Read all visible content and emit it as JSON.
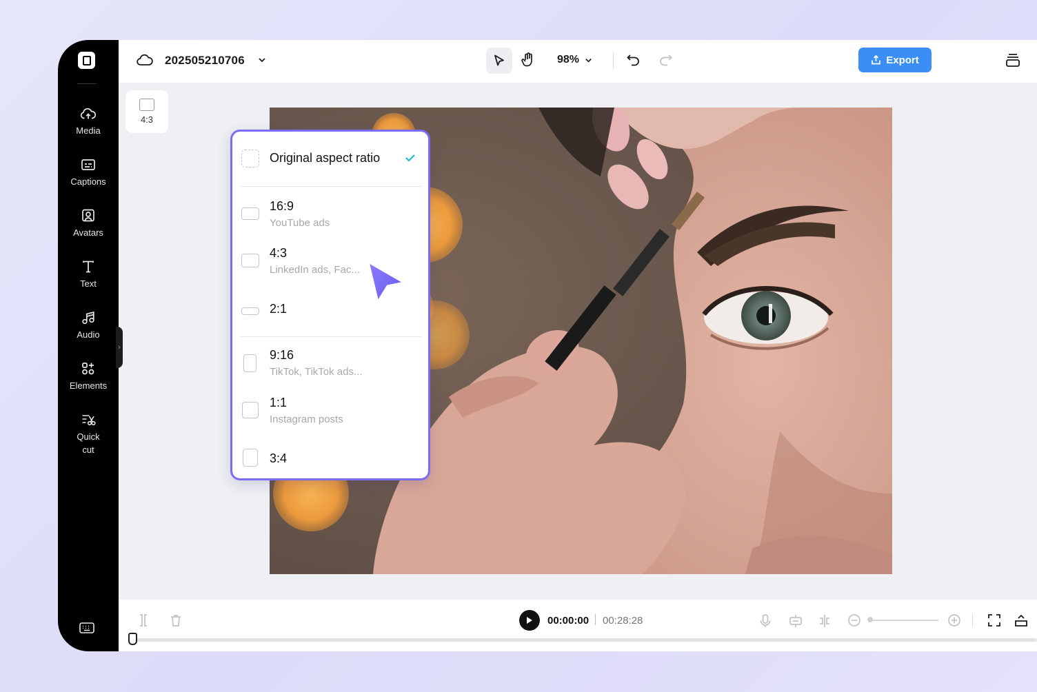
{
  "sidebar": {
    "items": [
      {
        "label": "Media",
        "icon": "cloud-upload-icon"
      },
      {
        "label": "Captions",
        "icon": "captions-icon"
      },
      {
        "label": "Avatars",
        "icon": "avatar-icon"
      },
      {
        "label": "Text",
        "icon": "text-icon"
      },
      {
        "label": "Audio",
        "icon": "music-note-icon"
      },
      {
        "label": "Elements",
        "icon": "elements-icon"
      },
      {
        "label": "Quick\ncut",
        "icon": "quick-cut-icon"
      }
    ],
    "bottom_icon": "keyboard-icon"
  },
  "header": {
    "project_name": "202505210706",
    "zoom": "98%",
    "export_label": "Export"
  },
  "canvas": {
    "current_ratio": "4:3"
  },
  "dropdown": {
    "original": {
      "title": "Original aspect ratio",
      "selected": true
    },
    "options": [
      {
        "title": "16:9",
        "subtitle": "YouTube ads"
      },
      {
        "title": "4:3",
        "subtitle": "LinkedIn ads, Fac..."
      },
      {
        "title": "2:1",
        "subtitle": ""
      },
      {
        "title": "9:16",
        "subtitle": "TikTok, TikTok ads..."
      },
      {
        "title": "1:1",
        "subtitle": "Instagram posts"
      },
      {
        "title": "3:4",
        "subtitle": ""
      }
    ]
  },
  "playback": {
    "current_time": "00:00:00",
    "total_time": "00:28:28"
  },
  "colors": {
    "accent": "#7b6cf6",
    "export": "#3b8ef5",
    "check": "#22b8cf"
  }
}
